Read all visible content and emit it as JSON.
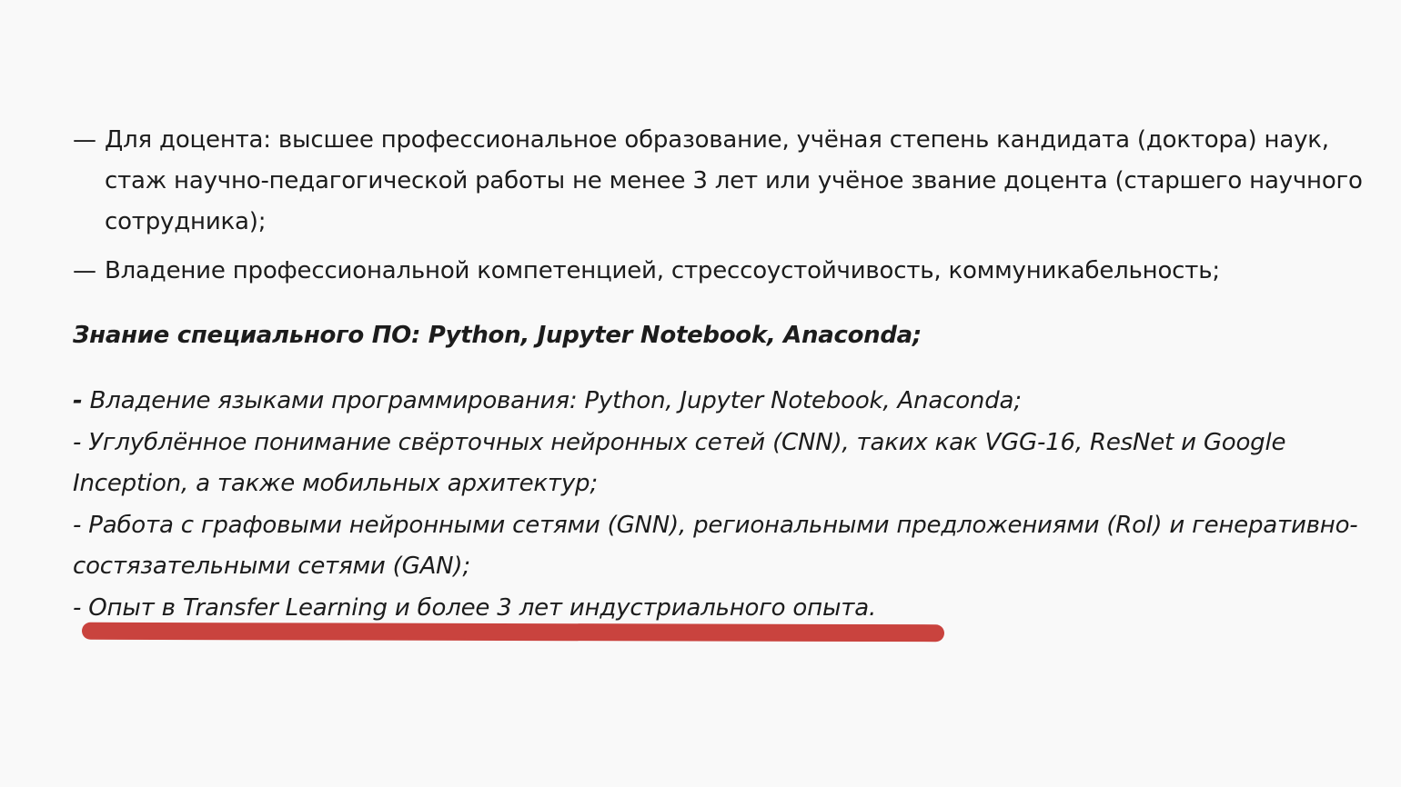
{
  "requirements_top": [
    {
      "dash": "—",
      "text": "Для доцента: высшее профессиональное образование, учёная степень кандидата (доктора) наук, стаж научно-педагогической работы не менее 3 лет или учёное звание доцента (старшего научного сотрудника);"
    },
    {
      "dash": "—",
      "text": "Владение профессиональной компетенцией, стрессоустойчивость, коммуникабельность;"
    }
  ],
  "heading": "Знание специального ПО: Python, Jupyter Notebook, Anaconda;",
  "requirements_bottom": [
    {
      "dash": "-",
      "text": " Владение языками программирования: Python, Jupyter Notebook, Anaconda;"
    },
    {
      "dash": "-",
      "text": " Углублённое понимание свёрточных нейронных сетей (CNN), таких как VGG-16, ResNet и Google Inception, а также мобильных архитектур;"
    },
    {
      "dash": "-",
      "text": " Работа с графовыми нейронными сетями (GNN), региональными предложениями (RoI) и генеративно-состязательными сетями (GAN);"
    },
    {
      "dash": "-",
      "text": " Опыт в Transfer Learning и более 3 лет индустриального опыта."
    }
  ],
  "highlight_color": "#c9433e"
}
